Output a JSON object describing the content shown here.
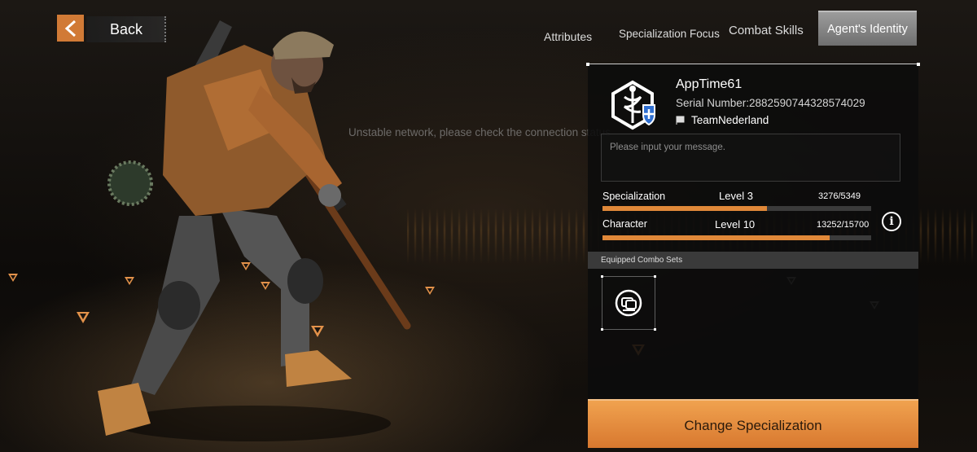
{
  "back": {
    "label": "Back"
  },
  "tabs": [
    {
      "label": "Attributes",
      "active": false
    },
    {
      "label": "Specialization Focus",
      "active": false
    },
    {
      "label": "Combat Skills",
      "active": false
    },
    {
      "label": "Agent's Identity",
      "active": true
    }
  ],
  "network_message": "Unstable network, please check the connection status",
  "agent": {
    "name": "AppTime61",
    "serial": "Serial Number:2882590744328574029",
    "team": "TeamNederland",
    "emblem_icon": "caduceus-shield-icon"
  },
  "message_input": {
    "placeholder": "Please input your message."
  },
  "stats": {
    "specialization": {
      "label": "Specialization",
      "level": "Level 3",
      "value": "3276/5349",
      "progress": 0.612
    },
    "character": {
      "label": "Character",
      "level": "Level 10",
      "value": "13252/15700",
      "progress": 0.844
    }
  },
  "combo": {
    "header": "Equipped Combo Sets",
    "slot_icon": "combo-set-icon"
  },
  "cta": {
    "label": "Change Specialization"
  },
  "colors": {
    "accent": "#e08839",
    "panel": "#0c0c0c",
    "tab_active": "#8a8a8a"
  }
}
